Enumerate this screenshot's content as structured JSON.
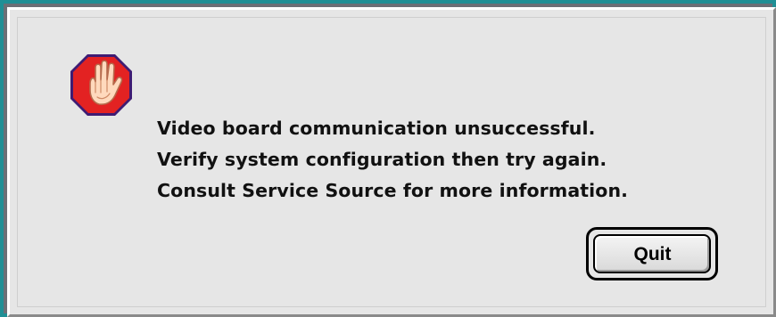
{
  "dialog": {
    "message_lines": [
      "Video board communication unsuccessful.",
      "Verify system configuration then try again.",
      "Consult Service Source for more information."
    ],
    "button": {
      "label": "Quit"
    },
    "icon": {
      "name": "stop-hand-icon"
    }
  },
  "colors": {
    "window_border": "#208f95",
    "dialog_background": "#e6e6e6",
    "stop_red": "#e32222",
    "hand": "#ffd9bd"
  }
}
